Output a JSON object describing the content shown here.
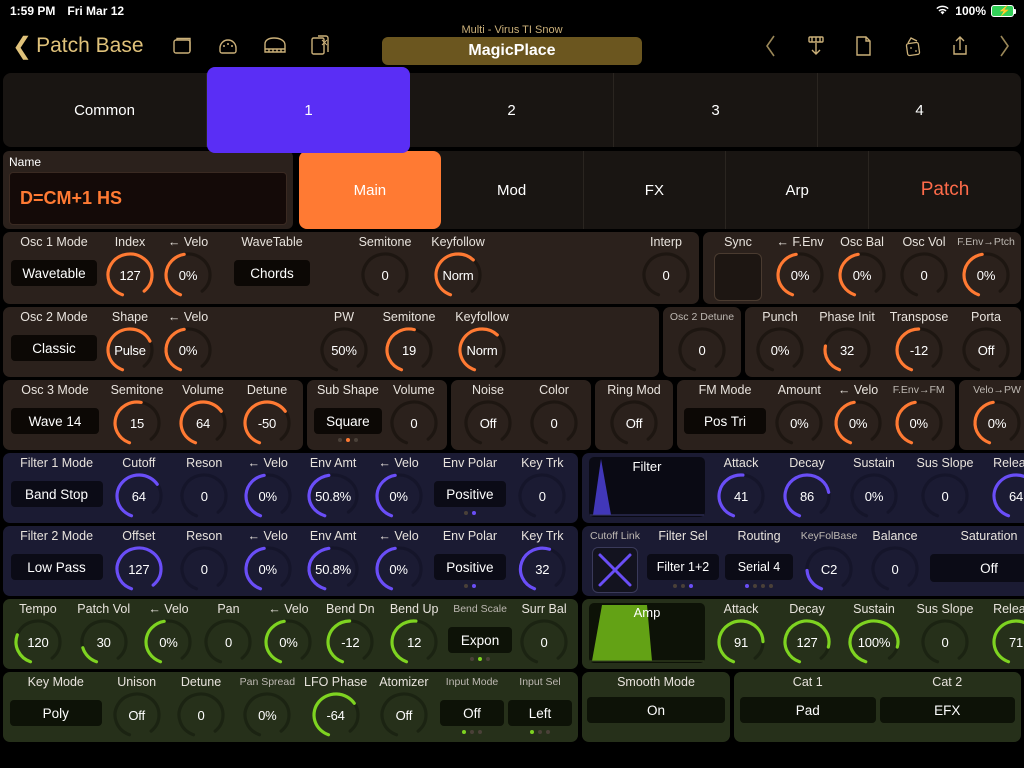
{
  "statusbar": {
    "time": "1:59 PM",
    "date": "Fri Mar 12",
    "battery": "100%",
    "wifi_icon": "wifi-icon"
  },
  "navbar": {
    "back_label": "Patch Base",
    "left_icons": [
      "folder-icon",
      "midi-din-icon",
      "piano-keyboard-icon",
      "documents-icon"
    ],
    "right_icons": [
      "chevron-left-icon",
      "import-icon",
      "new-document-icon",
      "dice-icon",
      "share-icon",
      "chevron-right-icon"
    ],
    "device_label": "Multi - Virus TI Snow",
    "patch_name": "MagicPlace"
  },
  "part_tabs": [
    {
      "label": "Common",
      "active": false
    },
    {
      "label": "1",
      "active": true
    },
    {
      "label": "2",
      "active": false
    },
    {
      "label": "3",
      "active": false
    },
    {
      "label": "4",
      "active": false
    }
  ],
  "name_panel": {
    "label": "Name",
    "value": "D=CM+1  HS"
  },
  "page_tabs": [
    {
      "label": "Main",
      "active": true
    },
    {
      "label": "Mod",
      "active": false
    },
    {
      "label": "FX",
      "active": false
    },
    {
      "label": "Arp",
      "active": false
    }
  ],
  "patch_button": "Patch",
  "colors": {
    "osc_accent": "#ff7a33",
    "filter_accent": "#6a4ef7",
    "amp_accent": "#7ed321",
    "part_active": "#5a2ef5",
    "page_active": "#ff7a33",
    "gold": "#cbb079"
  },
  "osc1": {
    "mode": {
      "label": "Osc 1 Mode",
      "value": "Wavetable",
      "type": "select"
    },
    "index": {
      "label": "Index",
      "value": "127",
      "pct": 100
    },
    "index_velo": {
      "label": "← Velo",
      "value": "0%",
      "pct": 50
    },
    "wavetable": {
      "label": "WaveTable",
      "value": "Chords",
      "type": "select"
    },
    "semitone": {
      "label": "Semitone",
      "value": "0",
      "pct": 0
    },
    "keyfollow": {
      "label": "Keyfollow",
      "value": "Norm",
      "pct": 68
    },
    "interp": {
      "label": "Interp",
      "value": "0",
      "pct": 0
    },
    "sync": {
      "label": "Sync",
      "value": "",
      "type": "square"
    },
    "fenv": {
      "label": "← F.Env",
      "value": "0%",
      "pct": 50
    },
    "osc_bal": {
      "label": "Osc Bal",
      "value": "0%",
      "pct": 50
    },
    "osc_vol": {
      "label": "Osc Vol",
      "value": "0",
      "pct": 0
    },
    "fenv_ptch": {
      "label": "F.Env→Ptch",
      "value": "0%",
      "pct": 50,
      "small": true
    }
  },
  "osc2": {
    "mode": {
      "label": "Osc 2 Mode",
      "value": "Classic",
      "type": "select"
    },
    "shape": {
      "label": "Shape",
      "value": "Pulse",
      "pct": 75
    },
    "shape_velo": {
      "label": "← Velo",
      "value": "0%",
      "pct": 50
    },
    "pw": {
      "label": "PW",
      "value": "50%",
      "pct": 0
    },
    "semitone": {
      "label": "Semitone",
      "value": "19",
      "pct": 58
    },
    "keyfollow": {
      "label": "Keyfollow",
      "value": "Norm",
      "pct": 68
    },
    "detune": {
      "label": "Osc 2 Detune",
      "value": "0",
      "pct": 0,
      "small": true
    },
    "punch": {
      "label": "Punch",
      "value": "0%",
      "pct": 0
    },
    "phase_init": {
      "label": "Phase Init",
      "value": "32",
      "pct": 27
    },
    "transpose": {
      "label": "Transpose",
      "value": "-12",
      "pct": 53
    },
    "porta": {
      "label": "Porta",
      "value": "Off",
      "pct": 0
    }
  },
  "osc3": {
    "mode": {
      "label": "Osc 3 Mode",
      "value": "Wave 14",
      "type": "select"
    },
    "semitone": {
      "label": "Semitone",
      "value": "15",
      "pct": 57
    },
    "volume": {
      "label": "Volume",
      "value": "64",
      "pct": 72
    },
    "detune": {
      "label": "Detune",
      "value": "-50",
      "pct": 72
    },
    "sub_shape": {
      "label": "Sub Shape",
      "value": "Square",
      "type": "select",
      "dots": [
        false,
        true,
        false
      ]
    },
    "sub_volume": {
      "label": "Volume",
      "value": "0",
      "pct": 0
    },
    "noise": {
      "label": "Noise",
      "value": "Off",
      "pct": 0
    },
    "color": {
      "label": "Color",
      "value": "0",
      "pct": 0
    },
    "ring_mod": {
      "label": "Ring Mod",
      "value": "Off",
      "pct": 0
    },
    "fm_mode": {
      "label": "FM Mode",
      "value": "Pos Tri",
      "type": "select"
    },
    "fm_amount": {
      "label": "Amount",
      "value": "0%",
      "pct": 0
    },
    "fm_velo": {
      "label": "← Velo",
      "value": "0%",
      "pct": 50
    },
    "fenv_fm": {
      "label": "F.Env→FM",
      "value": "0%",
      "pct": 50
    },
    "velo_pw": {
      "label": "Velo→PW",
      "value": "0%",
      "pct": 50
    }
  },
  "filter1": {
    "mode": {
      "label": "Filter 1 Mode",
      "value": "Band Stop",
      "type": "select"
    },
    "cutoff": {
      "label": "Cutoff",
      "value": "64",
      "pct": 72
    },
    "reson": {
      "label": "Reson",
      "value": "0",
      "pct": 0
    },
    "reson_velo": {
      "label": "← Velo",
      "value": "0%",
      "pct": 50
    },
    "env_amt": {
      "label": "Env Amt",
      "value": "50.8%",
      "pct": 50
    },
    "env_velo": {
      "label": "← Velo",
      "value": "0%",
      "pct": 50
    },
    "env_polar": {
      "label": "Env Polar",
      "value": "Positive",
      "type": "select",
      "dots": [
        false,
        true
      ]
    },
    "key_trk": {
      "label": "Key Trk",
      "value": "0",
      "pct": 0
    },
    "env_graph": {
      "label": "Filter",
      "shape": "spike"
    },
    "attack": {
      "label": "Attack",
      "value": "41",
      "pct": 55
    },
    "decay": {
      "label": "Decay",
      "value": "86",
      "pct": 80
    },
    "sustain": {
      "label": "Sustain",
      "value": "0%",
      "pct": 0
    },
    "sus_slope": {
      "label": "Sus Slope",
      "value": "0",
      "pct": 0
    },
    "release": {
      "label": "Release",
      "value": "64",
      "pct": 68
    }
  },
  "filter2": {
    "mode": {
      "label": "Filter 2 Mode",
      "value": "Low Pass",
      "type": "select"
    },
    "offset": {
      "label": "Offset",
      "value": "127",
      "pct": 100
    },
    "reson": {
      "label": "Reson",
      "value": "0",
      "pct": 0
    },
    "reson_velo": {
      "label": "← Velo",
      "value": "0%",
      "pct": 50
    },
    "env_amt": {
      "label": "Env Amt",
      "value": "50.8%",
      "pct": 50
    },
    "env_velo": {
      "label": "← Velo",
      "value": "0%",
      "pct": 50
    },
    "env_polar": {
      "label": "Env Polar",
      "value": "Positive",
      "type": "select",
      "dots": [
        false,
        true
      ]
    },
    "key_trk": {
      "label": "Key Trk",
      "value": "32",
      "pct": 60
    },
    "cutoff_link": {
      "label": "Cutoff Link",
      "value": "X",
      "small": true
    },
    "filter_sel": {
      "label": "Filter Sel",
      "value": "Filter 1+2",
      "type": "select",
      "dots": [
        false,
        false,
        true
      ]
    },
    "routing": {
      "label": "Routing",
      "value": "Serial 4",
      "type": "select",
      "dots": [
        true,
        false,
        false,
        false
      ]
    },
    "keyfol_base": {
      "label": "KeyFolBase",
      "value": "C2",
      "pct": 22,
      "small": true
    },
    "balance": {
      "label": "Balance",
      "value": "0",
      "pct": 0
    },
    "saturation": {
      "label": "Saturation",
      "value": "Off",
      "type": "select"
    }
  },
  "amp": {
    "tempo": {
      "label": "Tempo",
      "value": "120",
      "pct": 30
    },
    "patch_vol": {
      "label": "Patch Vol",
      "value": "30",
      "pct": 18
    },
    "patch_velo": {
      "label": "← Velo",
      "value": "0%",
      "pct": 50
    },
    "pan": {
      "label": "Pan",
      "value": "0",
      "pct": 0
    },
    "pan_velo": {
      "label": "← Velo",
      "value": "0%",
      "pct": 50
    },
    "bend_dn": {
      "label": "Bend Dn",
      "value": "-12",
      "pct": 53
    },
    "bend_up": {
      "label": "Bend Up",
      "value": "12",
      "pct": 55
    },
    "bend_scale": {
      "label": "Bend Scale",
      "value": "Expon",
      "type": "select",
      "small": true,
      "dots": [
        false,
        true,
        false
      ]
    },
    "surr_bal": {
      "label": "Surr Bal",
      "value": "0",
      "pct": 0
    },
    "env_graph": {
      "label": "Amp",
      "shape": "trapezoid"
    },
    "attack": {
      "label": "Attack",
      "value": "91",
      "pct": 83
    },
    "decay": {
      "label": "Decay",
      "value": "127",
      "pct": 88
    },
    "sustain": {
      "label": "Sustain",
      "value": "100%",
      "pct": 88
    },
    "sus_slope": {
      "label": "Sus Slope",
      "value": "0",
      "pct": 0
    },
    "release": {
      "label": "Release",
      "value": "71",
      "pct": 75
    }
  },
  "bottom": {
    "key_mode": {
      "label": "Key Mode",
      "value": "Poly",
      "type": "select"
    },
    "unison": {
      "label": "Unison",
      "value": "Off",
      "pct": 0
    },
    "detune": {
      "label": "Detune",
      "value": "0",
      "pct": 0
    },
    "pan_spread": {
      "label": "Pan Spread",
      "value": "0%",
      "pct": 0,
      "small": true
    },
    "lfo_phase": {
      "label": "LFO Phase",
      "value": "-64",
      "pct": 72
    },
    "atomizer": {
      "label": "Atomizer",
      "value": "Off",
      "pct": 0
    },
    "input_mode": {
      "label": "Input Mode",
      "value": "Off",
      "type": "select",
      "small": true,
      "dots": [
        true,
        false,
        false
      ]
    },
    "input_sel": {
      "label": "Input Sel",
      "value": "Left",
      "type": "select",
      "small": true,
      "dots": [
        true,
        false,
        false
      ]
    },
    "smooth_mode": {
      "label": "Smooth Mode",
      "value": "On",
      "type": "select"
    },
    "cat1": {
      "label": "Cat 1",
      "value": "Pad",
      "type": "select"
    },
    "cat2": {
      "label": "Cat 2",
      "value": "EFX",
      "type": "select"
    }
  }
}
